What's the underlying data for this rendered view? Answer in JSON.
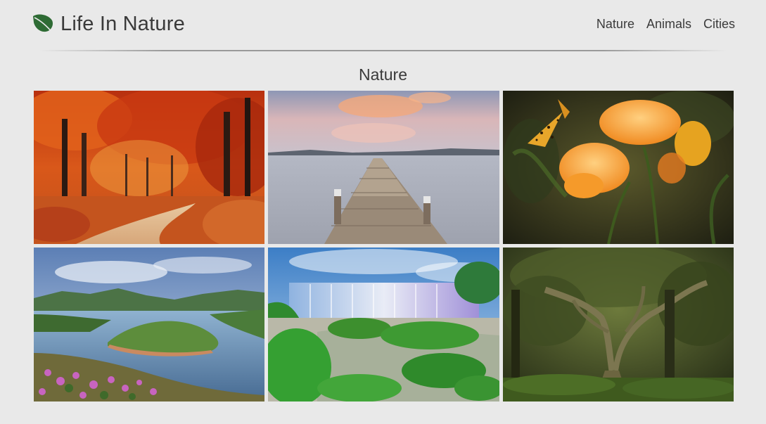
{
  "header": {
    "brand_title": "Life In Nature",
    "brand_icon": "leaf-icon",
    "nav": [
      {
        "label": "Nature"
      },
      {
        "label": "Animals"
      },
      {
        "label": "Cities"
      }
    ]
  },
  "section": {
    "title": "Nature"
  },
  "gallery": {
    "photos": [
      {
        "subject": "autumn forest path"
      },
      {
        "subject": "wooden pier on calm lake at sunset"
      },
      {
        "subject": "butterfly on orange flowers"
      },
      {
        "subject": "river bend around green island with pink flowers"
      },
      {
        "subject": "waterfall with lush greenery"
      },
      {
        "subject": "mossy tree in green forest"
      }
    ]
  },
  "colors": {
    "background": "#e9e9e9",
    "text": "#3a3a3a",
    "leaf": "#2e6b34"
  }
}
